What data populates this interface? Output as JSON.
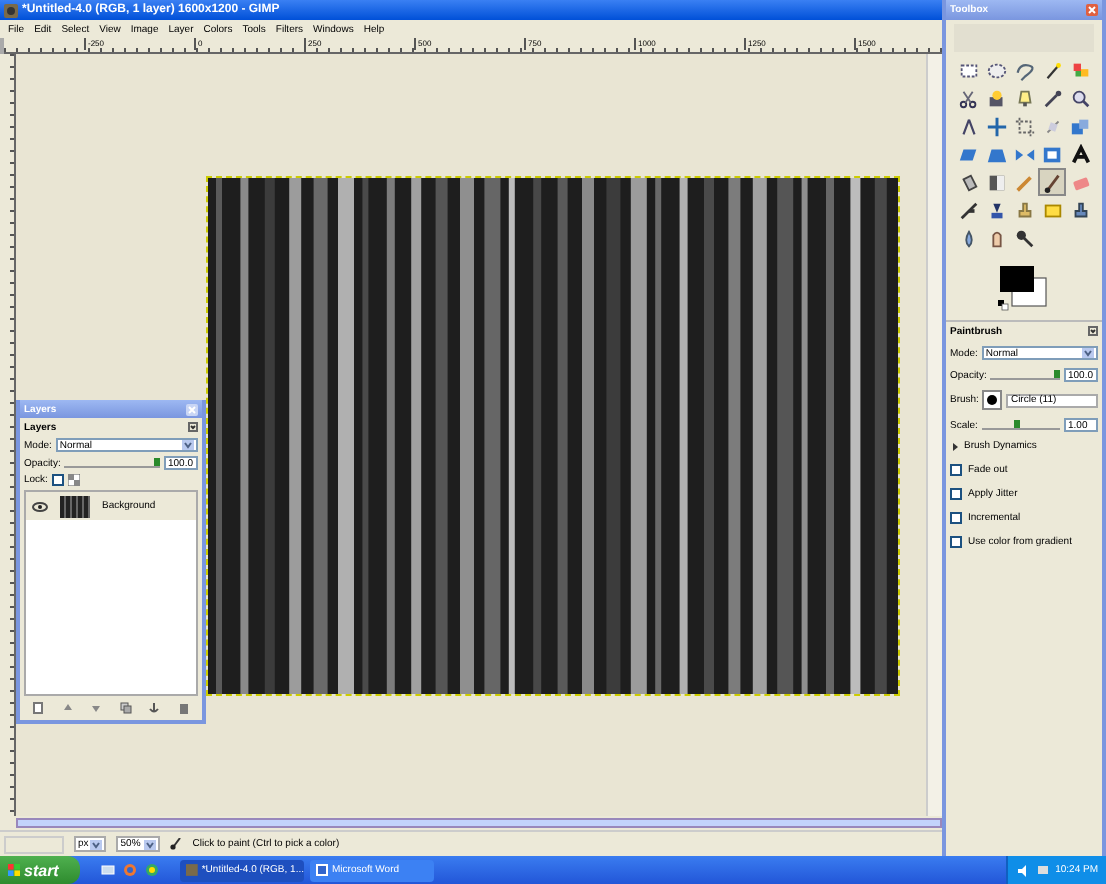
{
  "image_window": {
    "title": "*Untitled-4.0 (RGB, 1 layer) 1600x1200 - GIMP",
    "menu": [
      "File",
      "Edit",
      "Select",
      "View",
      "Image",
      "Layer",
      "Colors",
      "Tools",
      "Filters",
      "Windows",
      "Help"
    ],
    "ruler_labels": [
      "-250",
      "0",
      "250",
      "500",
      "750",
      "1000",
      "1250",
      "1500"
    ],
    "status_bar": {
      "unit": "px",
      "zoom": "50%",
      "message": "Click to paint (Ctrl to pick a color)"
    }
  },
  "layers_dock": {
    "title": "Layers",
    "tab": "Layers",
    "mode": {
      "label": "Mode:",
      "value": "Normal"
    },
    "opacity": {
      "label": "Opacity:",
      "value": "100.0",
      "level": 1
    },
    "lock": {
      "label": "Lock:",
      "checked": false
    },
    "layers": [
      {
        "name": "Background",
        "visible": true,
        "selected": true
      }
    ]
  },
  "toolbox": {
    "title": "Toolbox",
    "tools": [
      {
        "selected": false
      },
      {
        "selected": false
      },
      {
        "selected": false
      },
      {
        "selected": false
      },
      {
        "selected": false
      },
      {
        "selected": false
      },
      {
        "selected": false
      },
      {
        "selected": false
      },
      {
        "selected": false
      },
      {
        "selected": false
      },
      {
        "selected": false
      },
      {
        "selected": false
      },
      {
        "selected": false
      },
      {
        "selected": false
      },
      {
        "selected": false
      },
      {
        "selected": false
      },
      {
        "selected": false
      },
      {
        "selected": false
      },
      {
        "selected": false
      },
      {
        "selected": false
      },
      {
        "selected": false
      },
      {
        "selected": false
      },
      {
        "selected": false
      },
      {
        "selected": true
      },
      {
        "selected": false
      },
      {
        "selected": false
      },
      {
        "selected": false
      },
      {
        "selected": false
      },
      {
        "selected": false
      },
      {
        "selected": false
      },
      {
        "selected": false
      },
      {
        "selected": false
      },
      {
        "selected": false
      }
    ],
    "options": {
      "title": "Paintbrush",
      "mode": {
        "label": "Mode:",
        "value": "Normal"
      },
      "opacity": {
        "label": "Opacity:",
        "value": "100.0",
        "level": 1
      },
      "brush": {
        "label": "Brush:",
        "value": "Circle (11)"
      },
      "scale": {
        "label": "Scale:",
        "value": "1.00",
        "level": 0.5
      },
      "dynamics": {
        "label": "Brush Dynamics",
        "expanded": false
      },
      "checks": [
        {
          "label": "Fade out",
          "checked": false
        },
        {
          "label": "Apply Jitter",
          "checked": false
        },
        {
          "label": "Incremental",
          "checked": false
        },
        {
          "label": "Use color from gradient",
          "checked": false
        }
      ]
    }
  },
  "taskbar": {
    "start": "start",
    "tasks": [
      {
        "label": "*Untitled-4.0 (RGB, 1...",
        "selected": true
      },
      {
        "label": "Microsoft Word",
        "selected": false
      }
    ],
    "clock": "10:24 PM"
  }
}
